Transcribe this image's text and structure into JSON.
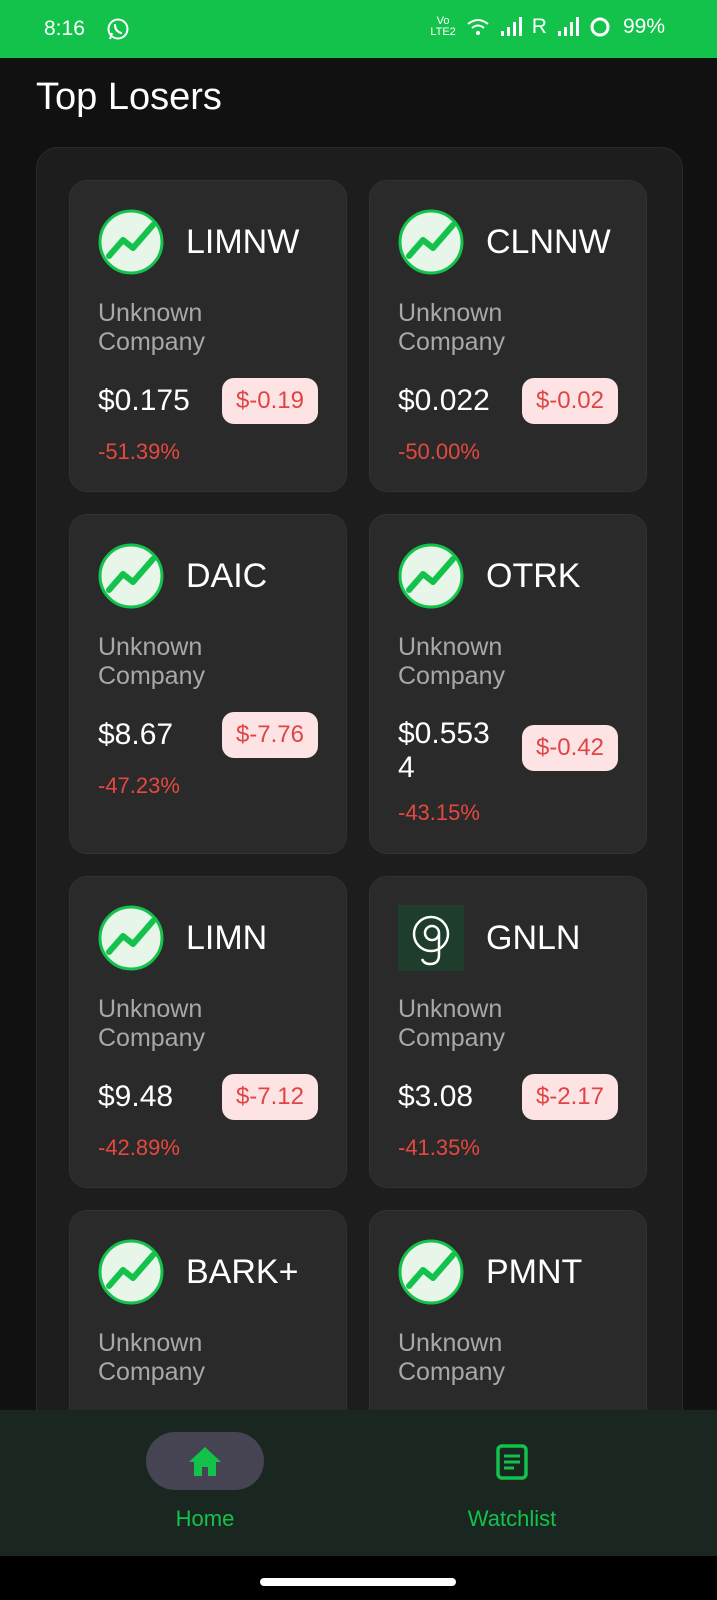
{
  "status_bar": {
    "time": "8:16",
    "network_label": "R",
    "battery": "99%",
    "lte_label": "LTE2"
  },
  "page": {
    "title": "Top Losers"
  },
  "stocks": [
    {
      "symbol": "LIMNW",
      "company": "Unknown Company",
      "price": "$0.175",
      "change": "$-0.19",
      "percent": "-51.39%",
      "logo": "trend-up-icon"
    },
    {
      "symbol": "CLNNW",
      "company": "Unknown Company",
      "price": "$0.022",
      "change": "$-0.02",
      "percent": "-50.00%",
      "logo": "trend-up-icon"
    },
    {
      "symbol": "DAIC",
      "company": "Unknown Company",
      "price": "$8.67",
      "change": "$-7.76",
      "percent": "-47.23%",
      "logo": "trend-up-icon"
    },
    {
      "symbol": "OTRK",
      "company": "Unknown Company",
      "price_line1": "$0.553",
      "price_line2": "4",
      "change": "$-0.42",
      "percent": "-43.15%",
      "logo": "trend-up-icon"
    },
    {
      "symbol": "LIMN",
      "company": "Unknown Company",
      "price": "$9.48",
      "change": "$-7.12",
      "percent": "-42.89%",
      "logo": "trend-up-icon"
    },
    {
      "symbol": "GNLN",
      "company": "Unknown Company",
      "price": "$3.08",
      "change": "$-2.17",
      "percent": "-41.35%",
      "logo": "greenlane-g-logo"
    },
    {
      "symbol": "BARK+",
      "company": "Unknown Company",
      "logo": "trend-up-icon"
    },
    {
      "symbol": "PMNT",
      "company": "Unknown Company",
      "logo": "trend-up-icon"
    }
  ],
  "nav": {
    "home_label": "Home",
    "watchlist_label": "Watchlist",
    "home_icon": "home-icon",
    "watchlist_icon": "list-document-icon"
  },
  "colors": {
    "accent": "#12c24a",
    "loss_text": "#e5483f",
    "loss_badge_bg": "#fde3e3",
    "background": "#111111",
    "card": "#2a2a2a"
  }
}
